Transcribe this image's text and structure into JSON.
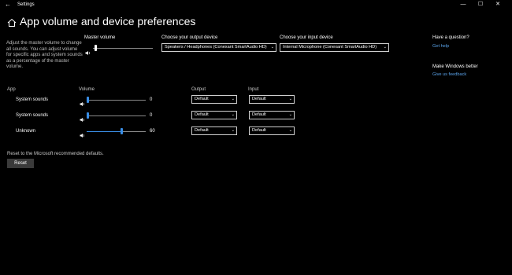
{
  "window": {
    "title": "Settings",
    "back_glyph": "←",
    "minimize_glyph": "—",
    "maximize_glyph": "☐",
    "close_glyph": "✕"
  },
  "header": {
    "title": "App volume and device preferences",
    "icon": "home-icon"
  },
  "description": "Adjust the master volume to change all sounds. You can adjust volume for specific apps and system sounds as a percentage of the master volume.",
  "master": {
    "label": "Master volume",
    "level_percent": 3
  },
  "output_device": {
    "label": "Choose your output device",
    "value": "Speakers / Headphones (Conexant SmartAudio HD)"
  },
  "input_device": {
    "label": "Choose your input device",
    "value": "Internal Microphone (Conexant SmartAudio HD)"
  },
  "table": {
    "headers": {
      "app": "App",
      "volume": "Volume",
      "output": "Output",
      "input": "Input"
    },
    "rows": [
      {
        "name": "System sounds",
        "volume": "0",
        "level_percent": 0,
        "output": "Default",
        "input": "Default"
      },
      {
        "name": "System sounds",
        "volume": "0",
        "level_percent": 0,
        "output": "Default",
        "input": "Default"
      },
      {
        "name": "Unknown",
        "volume": "60",
        "level_percent": 60,
        "output": "Default",
        "input": "Default"
      }
    ]
  },
  "reset": {
    "text": "Reset to the Microsoft recommended defaults.",
    "button_label": "Reset"
  },
  "side": {
    "question_heading": "Have a question?",
    "help_link": "Get help",
    "better_heading": "Make Windows better",
    "feedback_link": "Give us feedback"
  },
  "colors": {
    "accent": "#3a8ee6",
    "link": "#5aa3ea",
    "background": "#000000"
  },
  "chevron_glyph": "⌄"
}
